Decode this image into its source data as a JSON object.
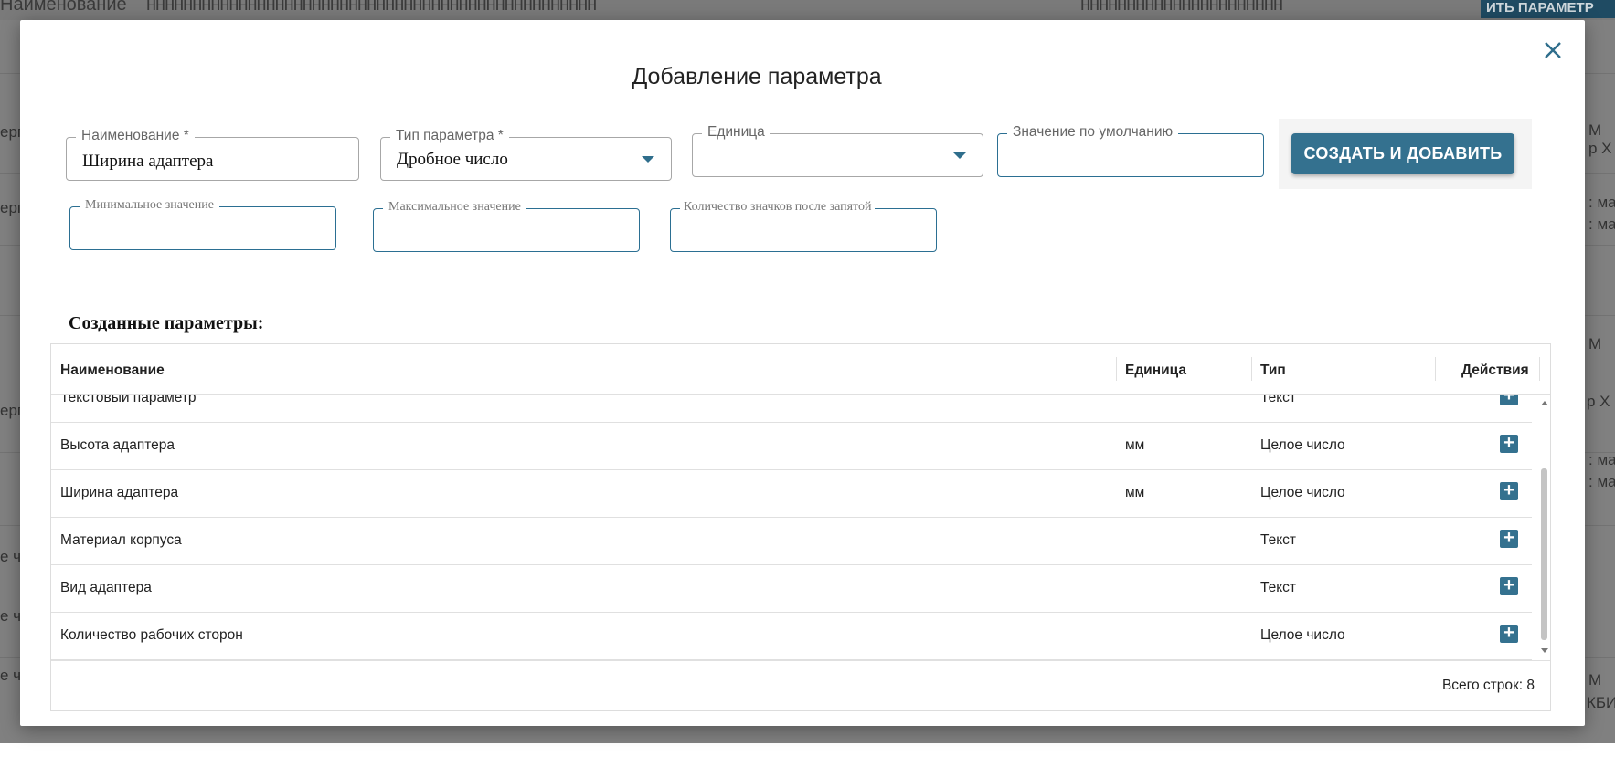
{
  "background": {
    "top_texts": [
      "Наименование",
      "ннннннннннннннннннннннннннннннннннннннннннннннннн",
      "нннннннннннннннннннннн"
    ],
    "top_button": "ИТЬ ПАРАМЕТР",
    "right_snippets": [
      "М",
      "р Х",
      ": ма",
      ": ма",
      "М",
      "р Х",
      ": ма",
      ": ма",
      "М",
      "КБИ"
    ],
    "left_snippets": [
      "ерг",
      "ерг",
      "",
      "ерг",
      "е ч",
      "е ч",
      "е ч"
    ]
  },
  "dialog": {
    "title": "Добавление параметра",
    "close_icon": "close-icon"
  },
  "form": {
    "name": {
      "label": "Наименование *",
      "value": "Ширина адаптера"
    },
    "type": {
      "label": "Тип параметра *",
      "value": "Дробное число"
    },
    "unit": {
      "label": "Единица",
      "value": ""
    },
    "default": {
      "label": "Значение по умолчанию",
      "value": ""
    },
    "min": {
      "label": "Минимальное значение",
      "value": ""
    },
    "max": {
      "label": "Максимальное значение",
      "value": ""
    },
    "decimals": {
      "label": "Количество значков после запятой",
      "value": ""
    },
    "submit_label": "СОЗДАТЬ И ДОБАВИТЬ"
  },
  "created": {
    "title": "Созданные параметры:",
    "columns": [
      "Наименование",
      "Единица",
      "Тип",
      "Действия"
    ],
    "rows": [
      {
        "name": "Текстовый параметр",
        "unit": "",
        "type": "Текст"
      },
      {
        "name": "Высота адаптера",
        "unit": "мм",
        "type": "Целое число"
      },
      {
        "name": "Ширина адаптера",
        "unit": "мм",
        "type": "Целое число"
      },
      {
        "name": "Материал корпуса",
        "unit": "",
        "type": "Текст"
      },
      {
        "name": "Вид адаптера",
        "unit": "",
        "type": "Текст"
      },
      {
        "name": "Количество рабочих сторон",
        "unit": "",
        "type": "Целое число"
      }
    ],
    "action_symbol": "+",
    "footer": "Всего строк: 8"
  }
}
